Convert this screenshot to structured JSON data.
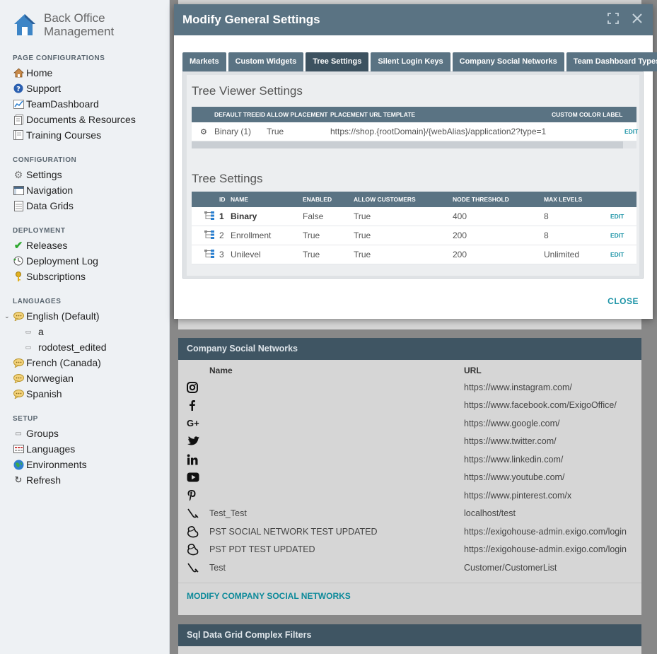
{
  "brand": {
    "line1": "Back Office",
    "line2": "Management"
  },
  "sidebar": {
    "sections": [
      {
        "title": "PAGE CONFIGURATIONS",
        "items": [
          {
            "label": "Home",
            "icon": "home-icon"
          },
          {
            "label": "Support",
            "icon": "help-icon"
          },
          {
            "label": "TeamDashboard",
            "icon": "chart-icon"
          },
          {
            "label": "Documents & Resources",
            "icon": "document-icon"
          },
          {
            "label": "Training Courses",
            "icon": "book-icon"
          }
        ]
      },
      {
        "title": "CONFIGURATION",
        "items": [
          {
            "label": "Settings",
            "icon": "gear-icon"
          },
          {
            "label": "Navigation",
            "icon": "window-icon"
          },
          {
            "label": "Data Grids",
            "icon": "grid-icon"
          }
        ]
      },
      {
        "title": "DEPLOYMENT",
        "items": [
          {
            "label": "Releases",
            "icon": "check-icon"
          },
          {
            "label": "Deployment Log",
            "icon": "history-icon"
          },
          {
            "label": "Subscriptions",
            "icon": "key-icon"
          }
        ]
      },
      {
        "title": "LANGUAGES",
        "items": [
          {
            "label": "English (Default)",
            "icon": "speech-icon",
            "expanded": true
          },
          {
            "label": "a",
            "icon": "square-icon",
            "sub": true
          },
          {
            "label": "rodotest_edited",
            "icon": "square-icon",
            "sub": true
          },
          {
            "label": "French (Canada)",
            "icon": "speech-icon"
          },
          {
            "label": "Norwegian",
            "icon": "speech-icon"
          },
          {
            "label": "Spanish",
            "icon": "speech-icon"
          }
        ]
      },
      {
        "title": "SETUP",
        "items": [
          {
            "label": "Groups",
            "icon": "square-icon"
          },
          {
            "label": "Languages",
            "icon": "table-icon"
          },
          {
            "label": "Environments",
            "icon": "globe-icon"
          },
          {
            "label": "Refresh",
            "icon": "refresh-icon"
          }
        ]
      }
    ]
  },
  "background": {
    "social_panel_title": "Company Social Networks",
    "col_name": "Name",
    "col_url": "URL",
    "rows": [
      {
        "icon": "instagram-icon",
        "name": "",
        "url": "https://www.instagram.com/"
      },
      {
        "icon": "facebook-icon",
        "name": "",
        "url": "https://www.facebook.com/ExigoOffice/"
      },
      {
        "icon": "google-plus-icon",
        "name": "",
        "url": "https://www.google.com/"
      },
      {
        "icon": "twitter-icon",
        "name": "",
        "url": "https://www.twitter.com/"
      },
      {
        "icon": "linkedin-icon",
        "name": "",
        "url": "https://www.linkedin.com/"
      },
      {
        "icon": "youtube-icon",
        "name": "",
        "url": "https://www.youtube.com/"
      },
      {
        "icon": "pinterest-icon",
        "name": "",
        "url": "https://www.pinterest.com/x"
      },
      {
        "icon": "custom-network-icon",
        "name": "Test_Test",
        "url": "localhost/test"
      },
      {
        "icon": "custom-network-icon",
        "name": "PST SOCIAL NETWORK TEST UPDATED",
        "url": "https://exigohouse-admin.exigo.com/login"
      },
      {
        "icon": "custom-network-icon",
        "name": "PST PDT TEST UPDATED",
        "url": "https://exigohouse-admin.exigo.com/login"
      },
      {
        "icon": "custom-network-icon",
        "name": "Test",
        "url": "Customer/CustomerList"
      }
    ],
    "modify_link": "MODIFY COMPANY SOCIAL NETWORKS",
    "sql_panel_title": "Sql Data Grid Complex Filters"
  },
  "modal": {
    "title": "Modify General Settings",
    "tabs": [
      {
        "label": "Markets",
        "active": false
      },
      {
        "label": "Custom Widgets",
        "active": false
      },
      {
        "label": "Tree Settings",
        "active": true
      },
      {
        "label": "Silent Login Keys",
        "active": false
      },
      {
        "label": "Company Social Networks",
        "active": false
      },
      {
        "label": "Team Dashboard Types",
        "active": false
      }
    ],
    "viewer": {
      "heading": "Tree Viewer Settings",
      "columns": [
        "DEFAULT TREEID",
        "ALLOW PLACEMENT",
        "PLACEMENT URL TEMPLATE",
        "CUSTOM COLOR LABEL"
      ],
      "row": {
        "tree": "Binary (1)",
        "allow": "True",
        "url": "https://shop.{rootDomain}/{webAlias}/application2?type=1",
        "edit": "EDIT"
      }
    },
    "trees": {
      "heading": "Tree Settings",
      "columns": [
        "ID",
        "NAME",
        "ENABLED",
        "ALLOW CUSTOMERS",
        "NODE THRESHOLD",
        "MAX LEVELS"
      ],
      "rows": [
        {
          "id": "1",
          "name": "Binary",
          "enabled": "False",
          "allow": "True",
          "threshold": "400",
          "max": "8",
          "edit": "EDIT"
        },
        {
          "id": "2",
          "name": "Enrollment",
          "enabled": "True",
          "allow": "True",
          "threshold": "200",
          "max": "8",
          "edit": "EDIT"
        },
        {
          "id": "3",
          "name": "Unilevel",
          "enabled": "True",
          "allow": "True",
          "threshold": "200",
          "max": "Unlimited",
          "edit": "EDIT"
        }
      ]
    },
    "close_label": "CLOSE"
  }
}
